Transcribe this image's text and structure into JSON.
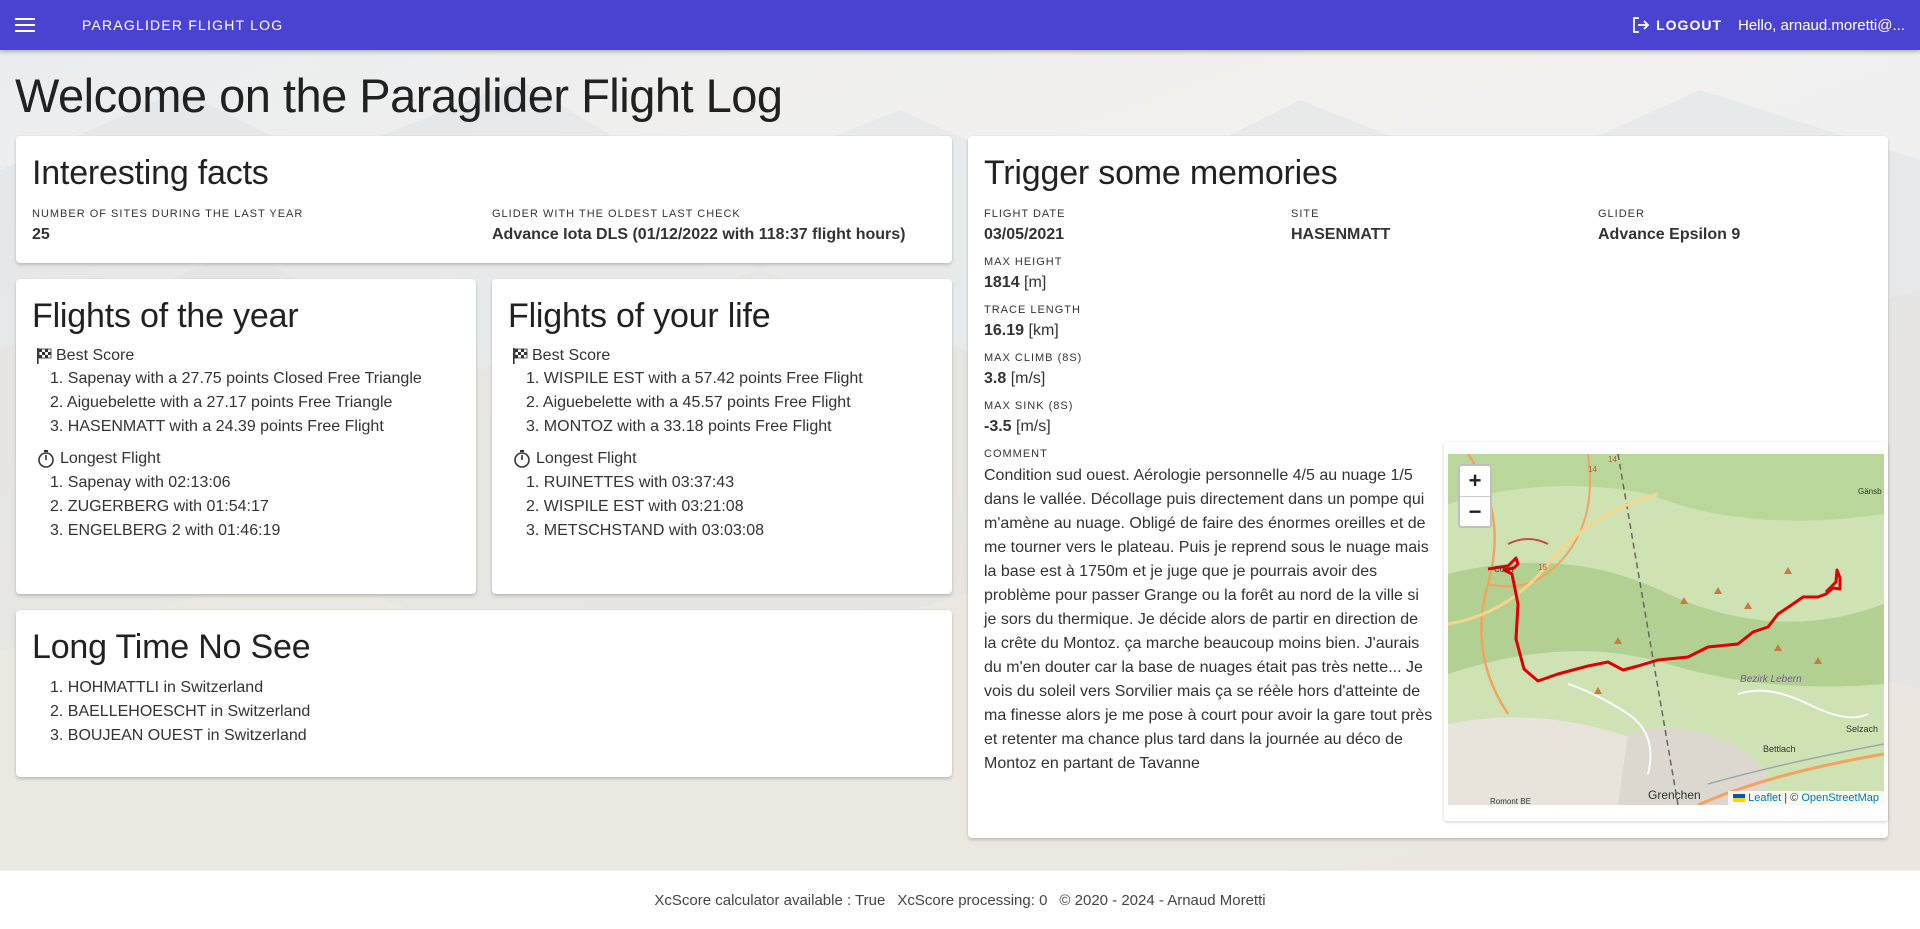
{
  "appbar": {
    "title": "PARAGLIDER FLIGHT LOG",
    "logout_label": "LOGOUT",
    "greeting": "Hello, arnaud.moretti@...",
    "color": "#4a43d1"
  },
  "page_title": "Welcome on the Paraglider Flight Log",
  "facts": {
    "title": "Interesting facts",
    "sites_label": "NUMBER OF SITES DURING THE LAST YEAR",
    "sites_value": "25",
    "glider_label": "GLIDER WITH THE OLDEST LAST CHECK",
    "glider_value": "Advance Iota DLS (01/12/2022 with 118:37 flight hours)"
  },
  "year": {
    "title": "Flights of the year",
    "best_label": "Best Score",
    "best": [
      "1. Sapenay with a 27.75 points Closed Free Triangle",
      "2. Aiguebelette with a 27.17 points Free Triangle",
      "3. HASENMATT with a 24.39 points Free Flight"
    ],
    "longest_label": "Longest Flight",
    "longest": [
      "1. Sapenay with 02:13:06",
      "2. ZUGERBERG with 01:54:17",
      "3. ENGELBERG 2 with 01:46:19"
    ]
  },
  "life": {
    "title": "Flights of your life",
    "best_label": "Best Score",
    "best": [
      "1. WISPILE EST with a 57.42 points Free Flight",
      "2. Aiguebelette with a 45.57 points Free Flight",
      "3. MONTOZ with a 33.18 points Free Flight"
    ],
    "longest_label": "Longest Flight",
    "longest": [
      "1. RUINETTES with 03:37:43",
      "2. WISPILE EST with 03:21:08",
      "3. METSCHSTAND with 03:03:08"
    ]
  },
  "longtime": {
    "title": "Long Time No See",
    "items": [
      "1. HOHMATTLI in Switzerland",
      "2. BAELLEHOESCHT in Switzerland",
      "3. BOUJEAN OUEST in Switzerland"
    ]
  },
  "memories": {
    "title": "Trigger some memories",
    "flight_date_label": "FLIGHT DATE",
    "flight_date": "03/05/2021",
    "site_label": "SITE",
    "site": "HASENMATT",
    "glider_label": "GLIDER",
    "glider": "Advance Epsilon 9",
    "max_height_label": "MAX HEIGHT",
    "max_height": "1814",
    "max_height_unit": "[m]",
    "trace_label": "TRACE LENGTH",
    "trace": "16.19",
    "trace_unit": "[km]",
    "climb_label": "MAX CLIMB (8S)",
    "climb": "3.8",
    "climb_unit": "[m/s]",
    "sink_label": "MAX SINK (8S)",
    "sink": "-3.5",
    "sink_unit": "[m/s]",
    "comment_label": "COMMENT",
    "comment": "Condition sud ouest. Aérologie personnelle 4/5 au nuage 1/5 dans le vallée. Décollage puis directement dans un pompe qui m'amène au nuage. Obligé de faire des énormes oreilles et de me tourner vers le plateau. Puis je reprend sous le nuage mais la base est à 1750m et je juge que je pourrais avoir des problème pour passer Grange ou la forêt au nord de la ville si je sors du thermique. Je décide alors de partir en direction de la crête du Montoz. ça marche beaucoup moins bien. J'aurais du m'en douter car la base de nuages était pas très nette... Je vois du soleil vers Sorvilier mais ça se réèle hors d'atteinte de ma finesse alors je me pose à court pour avoir la gare tout près et retenter ma chance plus tard dans la journée au déco de Montoz en partant de Tavanne"
  },
  "map": {
    "zoom_in": "+",
    "zoom_out": "−",
    "attrib_leaflet": "Leaflet",
    "attrib_sep": "| ©",
    "attrib_osm": "OpenStreetMap",
    "labels": {
      "grenchen": "Grenchen",
      "bettlach": "Bettlach",
      "selzach": "Selzach",
      "bezirk": "Bezirk Lebern",
      "court": "Court",
      "gansb": "Gänsb",
      "road14a": "14",
      "road14b": "14",
      "road15": "15",
      "bottom": "Romont BE"
    },
    "track_color": "#e00000"
  },
  "footer": {
    "calculator": "XcScore calculator available : True",
    "processing": "XcScore processing: 0",
    "copyright": "© 2020 - 2024 - Arnaud Moretti"
  }
}
